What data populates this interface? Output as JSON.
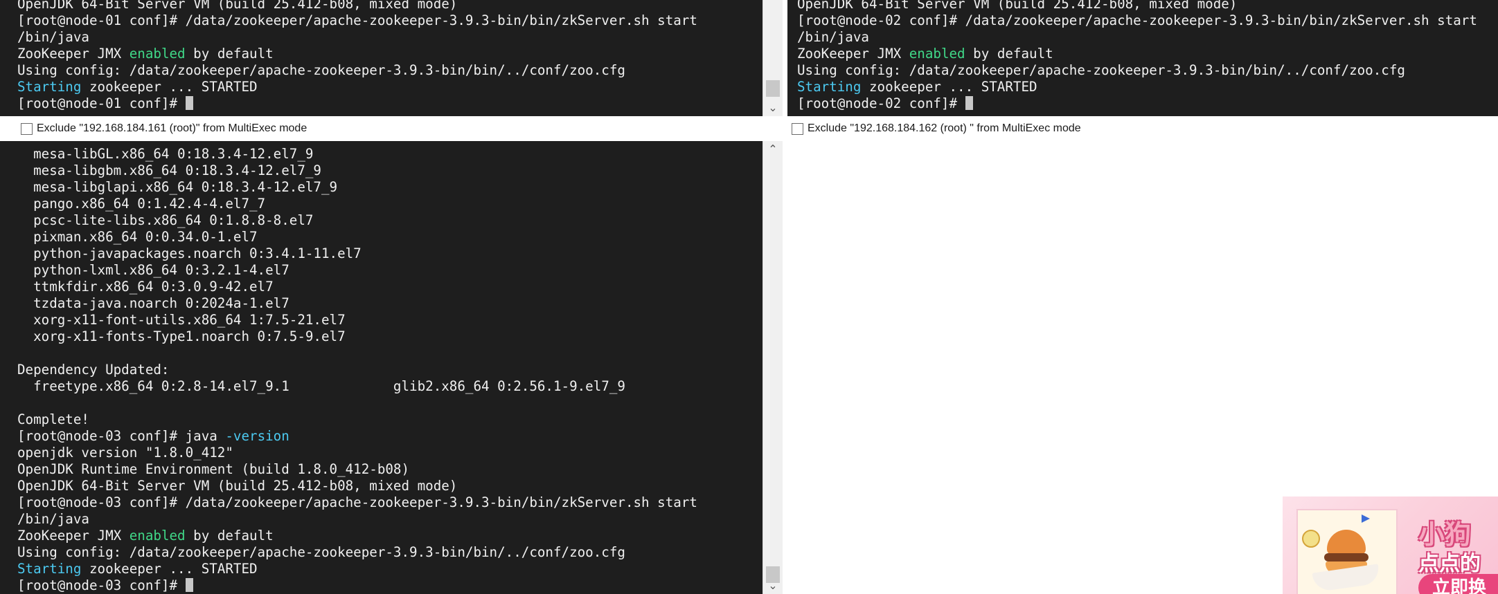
{
  "panes": [
    {
      "id": "node-01",
      "lines": [
        [
          {
            "t": "OpenJDK 64-Bit Server VM (build 25.412-b08, mixed mode)"
          }
        ],
        [
          {
            "t": "[root@node-01 conf]# /data/zookeeper/apache-zookeeper-3.9.3-bin/bin/zkServer.sh start"
          }
        ],
        [
          {
            "t": "/bin/java"
          }
        ],
        [
          {
            "t": "ZooKeeper JMX "
          },
          {
            "t": "enabled",
            "c": "green"
          },
          {
            "t": " by default"
          }
        ],
        [
          {
            "t": "Using config: /data/zookeeper/apache-zookeeper-3.9.3-bin/bin/../conf/zoo.cfg"
          }
        ],
        [
          {
            "t": "Starting",
            "c": "cyan"
          },
          {
            "t": " zookeeper ... STARTED"
          }
        ],
        [
          {
            "t": "[root@node-01 conf]# "
          },
          {
            "cursor": true
          }
        ]
      ],
      "exclude_label": "Exclude \"192.168.184.161 (root)\" from MultiExec mode"
    },
    {
      "id": "node-02",
      "lines": [
        [
          {
            "t": "OpenJDK 64-Bit Server VM (build 25.412-b08, mixed mode)"
          }
        ],
        [
          {
            "t": "[root@node-02 conf]# /data/zookeeper/apache-zookeeper-3.9.3-bin/bin/zkServer.sh start"
          }
        ],
        [
          {
            "t": "/bin/java"
          }
        ],
        [
          {
            "t": "ZooKeeper JMX "
          },
          {
            "t": "enabled",
            "c": "green"
          },
          {
            "t": " by default"
          }
        ],
        [
          {
            "t": "Using config: /data/zookeeper/apache-zookeeper-3.9.3-bin/bin/../conf/zoo.cfg"
          }
        ],
        [
          {
            "t": "Starting",
            "c": "cyan"
          },
          {
            "t": " zookeeper ... STARTED"
          }
        ],
        [
          {
            "t": "[root@node-02 conf]# "
          },
          {
            "cursor": true
          }
        ]
      ],
      "exclude_label": "Exclude \"192.168.184.162 (root) \" from MultiExec mode"
    },
    {
      "id": "node-03",
      "lines": [
        [
          {
            "t": "  mesa-libGL.x86_64 0:18.3.4-12.el7_9"
          }
        ],
        [
          {
            "t": "  mesa-libgbm.x86_64 0:18.3.4-12.el7_9"
          }
        ],
        [
          {
            "t": "  mesa-libglapi.x86_64 0:18.3.4-12.el7_9"
          }
        ],
        [
          {
            "t": "  pango.x86_64 0:1.42.4-4.el7_7"
          }
        ],
        [
          {
            "t": "  pcsc-lite-libs.x86_64 0:1.8.8-8.el7"
          }
        ],
        [
          {
            "t": "  pixman.x86_64 0:0.34.0-1.el7"
          }
        ],
        [
          {
            "t": "  python-javapackages.noarch 0:3.4.1-11.el7"
          }
        ],
        [
          {
            "t": "  python-lxml.x86_64 0:3.2.1-4.el7"
          }
        ],
        [
          {
            "t": "  ttmkfdir.x86_64 0:3.0.9-42.el7"
          }
        ],
        [
          {
            "t": "  tzdata-java.noarch 0:2024a-1.el7"
          }
        ],
        [
          {
            "t": "  xorg-x11-font-utils.x86_64 1:7.5-21.el7"
          }
        ],
        [
          {
            "t": "  xorg-x11-fonts-Type1.noarch 0:7.5-9.el7"
          }
        ],
        [
          {
            "t": ""
          }
        ],
        [
          {
            "t": "Dependency Updated:"
          }
        ],
        [
          {
            "t": "  freetype.x86_64 0:2.8-14.el7_9.1             glib2.x86_64 0:2.56.1-9.el7_9"
          }
        ],
        [
          {
            "t": ""
          }
        ],
        [
          {
            "t": "Complete!"
          }
        ],
        [
          {
            "t": "[root@node-03 conf]# java "
          },
          {
            "t": "-version",
            "c": "cyan"
          }
        ],
        [
          {
            "t": "openjdk version \"1.8.0_412\""
          }
        ],
        [
          {
            "t": "OpenJDK Runtime Environment (build 1.8.0_412-b08)"
          }
        ],
        [
          {
            "t": "OpenJDK 64-Bit Server VM (build 25.412-b08, mixed mode)"
          }
        ],
        [
          {
            "t": "[root@node-03 conf]# /data/zookeeper/apache-zookeeper-3.9.3-bin/bin/zkServer.sh start"
          }
        ],
        [
          {
            "t": "/bin/java"
          }
        ],
        [
          {
            "t": "ZooKeeper JMX "
          },
          {
            "t": "enabled",
            "c": "green"
          },
          {
            "t": " by default"
          }
        ],
        [
          {
            "t": "Using config: /data/zookeeper/apache-zookeeper-3.9.3-bin/bin/../conf/zoo.cfg"
          }
        ],
        [
          {
            "t": "Starting",
            "c": "cyan"
          },
          {
            "t": " zookeeper ... STARTED"
          }
        ],
        [
          {
            "t": "[root@node-03 conf]# "
          },
          {
            "cursor": true
          }
        ]
      ]
    }
  ],
  "ad": {
    "title": "小狗",
    "subtitle": "点点的",
    "button": "立即换"
  },
  "colors": {
    "terminal_bg": "#1e1e1e",
    "terminal_fg": "#f0f0f0",
    "keyword_green": "#40d888",
    "keyword_cyan": "#4cc9f0",
    "scrollbar": "#f0f0f0"
  }
}
